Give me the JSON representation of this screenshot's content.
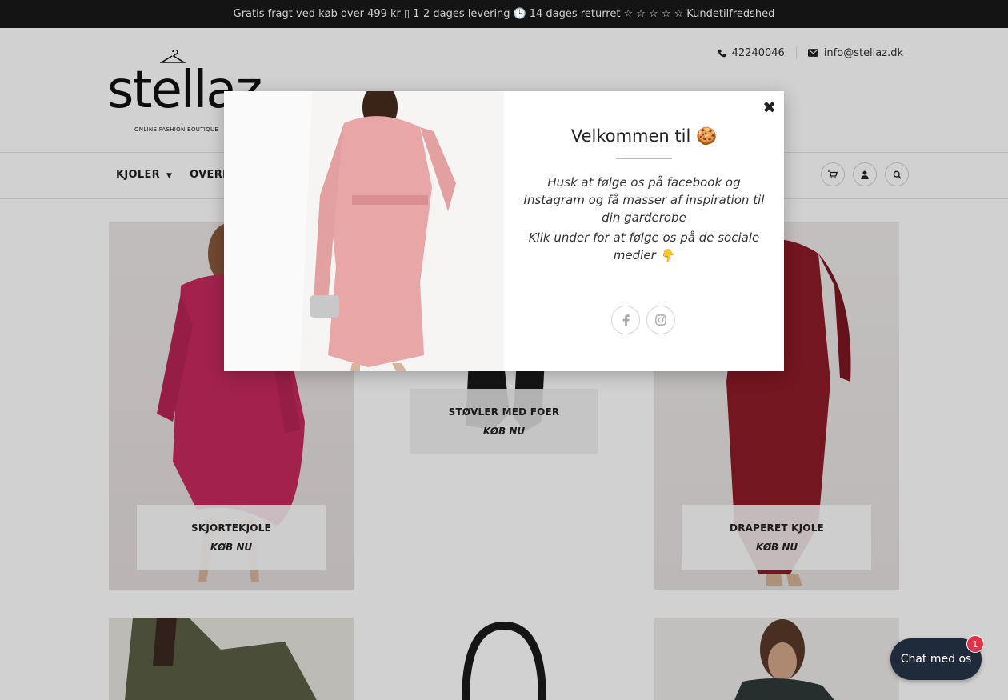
{
  "announcement": {
    "free_shipping": "Gratis fragt ved køb over 499 kr",
    "box_glyph": "▯",
    "delivery": "1-2 dages levering",
    "clock_glyph": "🕒",
    "returns": "14 dages returret",
    "stars": "☆ ☆ ☆ ☆ ☆",
    "satisfaction": "Kundetilfredshed"
  },
  "header": {
    "phone": "42240046",
    "email": "info@stellaz.dk",
    "logo_word": "stellaz",
    "logo_tagline": "ONLINE FASHION BOUTIQUE"
  },
  "nav": {
    "items": [
      {
        "label": "KJOLER",
        "has_dropdown": true
      },
      {
        "label": "OVERDELE",
        "has_dropdown": false
      }
    ],
    "icons": [
      "cart-icon",
      "user-icon",
      "search-icon"
    ]
  },
  "products": [
    {
      "name": "SKJORTEKJOLE",
      "cta": "KØB NU"
    },
    {
      "name": "STØVLER MED FOER",
      "cta": "KØB NU"
    },
    {
      "name": "DRAPERET KJOLE",
      "cta": "KØB NU"
    }
  ],
  "modal": {
    "title": "Velkommen til",
    "title_emoji": "🍪",
    "paragraph1": "Husk at følge os på facebook og Instagram og få masser af inspiration til din garderobe",
    "paragraph2": "Klik under for at følge os på de sociale medier 👇",
    "close_glyph": "✖",
    "social": [
      "facebook-icon",
      "instagram-icon"
    ]
  },
  "chat": {
    "label": "Chat med os",
    "badge": "1"
  },
  "colors": {
    "topbar": "#141414",
    "chat_bg": "#1f2b3a",
    "badge": "#e0334a"
  }
}
